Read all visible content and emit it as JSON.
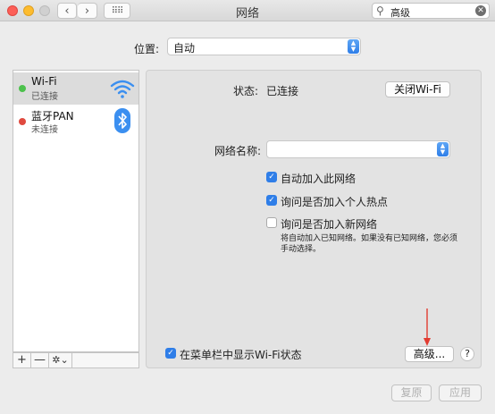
{
  "window": {
    "title": "网络"
  },
  "toolbar": {
    "back": "‹",
    "forward": "›",
    "grid": "⠿⠿",
    "search_value": "高级",
    "search_clear": "✕"
  },
  "location": {
    "label": "位置:",
    "value": "自动"
  },
  "services": [
    {
      "name": "Wi-Fi",
      "status": "已连接",
      "status_color": "#4cc14c",
      "icon": "wifi-icon",
      "selected": true
    },
    {
      "name": "蓝牙PAN",
      "status": "未连接",
      "status_color": "#e04a3f",
      "icon": "bluetooth-icon",
      "selected": false
    }
  ],
  "sidebar_tools": {
    "add": "+",
    "remove": "—",
    "gear": "✲⌄"
  },
  "wifi": {
    "status_label": "状态:",
    "status_value": "已连接",
    "turn_off_button": "关闭Wi-Fi",
    "network_name_label": "网络名称:",
    "network_name_value": "",
    "options": [
      {
        "label": "自动加入此网络",
        "checked": true
      },
      {
        "label": "询问是否加入个人热点",
        "checked": true
      },
      {
        "label": "询问是否加入新网络",
        "checked": false
      }
    ],
    "note_line1": "将自动加入已知网络。如果没有已知网络，您必须",
    "note_line2": "手动选择。",
    "show_in_menubar_label": "在菜单栏中显示Wi-Fi状态",
    "show_in_menubar_checked": true,
    "advanced_button": "高级...",
    "help": "?"
  },
  "footer": {
    "revert_button": "复原",
    "apply_button": "应用"
  },
  "colors": {
    "accent": "#2f7ee8",
    "annotation_arrow": "#e23b30"
  }
}
